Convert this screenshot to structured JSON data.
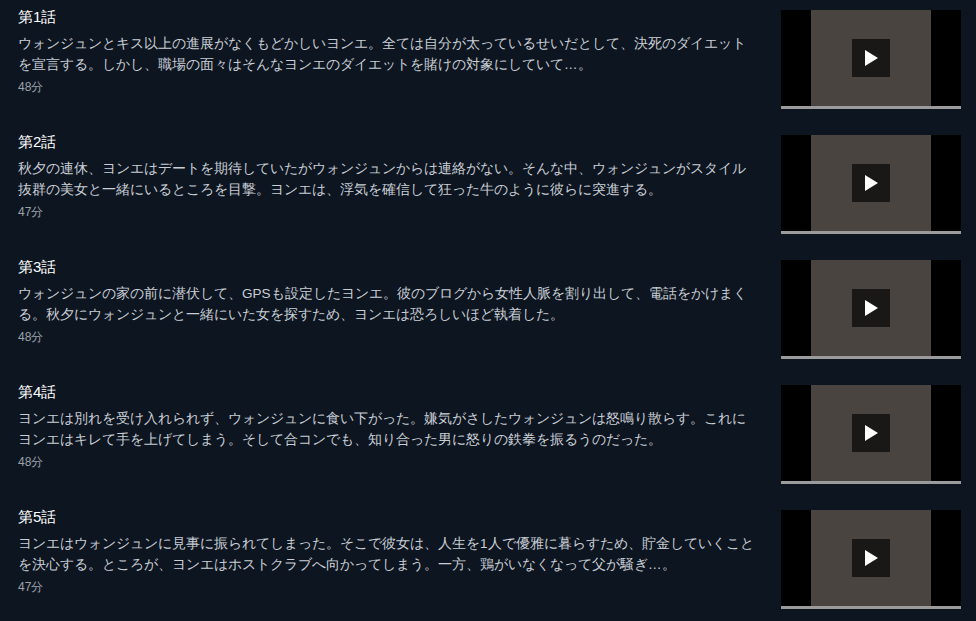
{
  "episodes": [
    {
      "title": "第1話",
      "description": "ウォンジュンとキス以上の進展がなくもどかしいヨンエ。全ては自分が太っているせいだとして、決死のダイエットを宣言する。しかし、職場の面々はそんなヨンエのダイエットを賭けの対象にしていて…。",
      "duration": "48分"
    },
    {
      "title": "第2話",
      "description": "秋夕の連休、ヨンエはデートを期待していたがウォンジュンからは連絡がない。そんな中、ウォンジュンがスタイル抜群の美女と一緒にいるところを目撃。ヨンエは、浮気を確信して狂った牛のように彼らに突進する。",
      "duration": "47分"
    },
    {
      "title": "第3話",
      "description": "ウォンジュンの家の前に潜伏して、GPSも設定したヨンエ。彼のブログから女性人脈を割り出して、電話をかけまくる。秋夕にウォンジュンと一緒にいた女を探すため、ヨンエは恐ろしいほど執着した。",
      "duration": "48分"
    },
    {
      "title": "第4話",
      "description": "ヨンエは別れを受け入れられず、ウォンジュンに食い下がった。嫌気がさしたウォンジュンは怒鳴り散らす。これにヨンエはキレて手を上げてしまう。そして合コンでも、知り合った男に怒りの鉄拳を振るうのだった。",
      "duration": "48分"
    },
    {
      "title": "第5話",
      "description": "ヨンエはウォンジュンに見事に振られてしまった。そこで彼女は、人生を1人で優雅に暮らすため、貯金していくことを決心する。ところが、ヨンエはホストクラブへ向かってしまう。一方、鶏がいなくなって父が騒ぎ…。",
      "duration": "47分"
    }
  ]
}
